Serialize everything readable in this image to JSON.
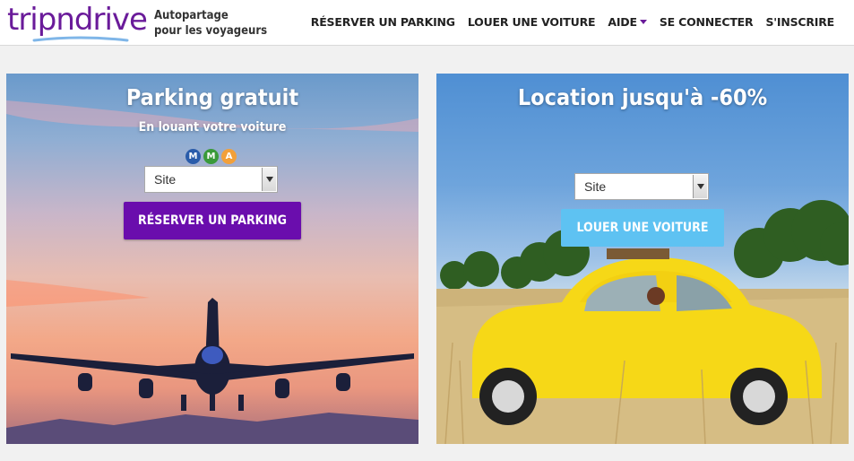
{
  "header": {
    "logo_text": "tripndrive",
    "tagline_line1": "Autopartage",
    "tagline_line2": "pour les voyageurs",
    "nav": [
      {
        "label": "RÉSERVER UN PARKING"
      },
      {
        "label": "LOUER UNE VOITURE"
      },
      {
        "label": "AIDE"
      },
      {
        "label": "SE CONNECTER"
      },
      {
        "label": "S'INSCRIRE"
      }
    ]
  },
  "parking_panel": {
    "title": "Parking gratuit",
    "subtitle": "En louant votre voiture",
    "badges": [
      "M",
      "M",
      "A"
    ],
    "select_value": "Site",
    "button_label": "RÉSERVER UN PARKING"
  },
  "rental_panel": {
    "title": "Location jusqu'à -60%",
    "select_value": "Site",
    "button_label": "LOUER UNE VOITURE"
  },
  "colors": {
    "brand_purple": "#6a1b9a",
    "button_purple": "#6a0dad",
    "button_blue": "#5ec2f2",
    "badge_1": "#2a5caa",
    "badge_2": "#3a9a3a",
    "badge_3": "#f2a03a"
  }
}
